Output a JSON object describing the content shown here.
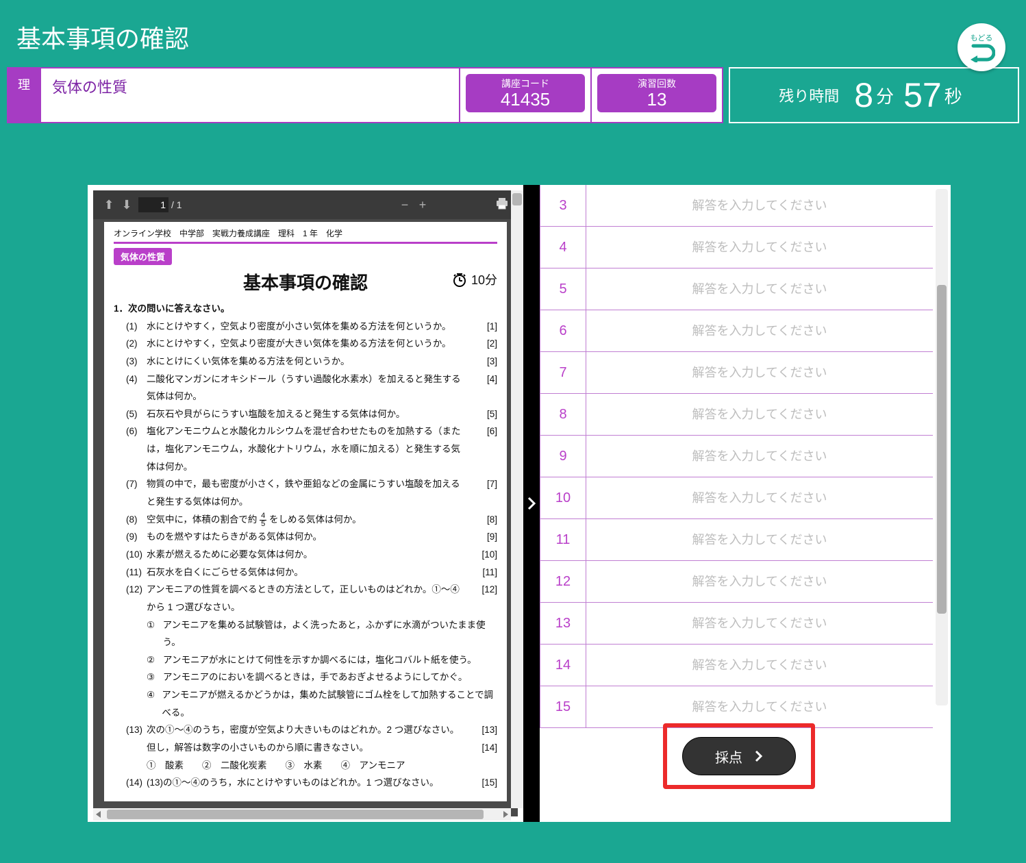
{
  "header": {
    "page_title": "基本事項の確認",
    "back_label": "もどる"
  },
  "info": {
    "subject_tab": "理",
    "topic": "気体の性質",
    "course_code_label": "講座コード",
    "course_code_value": "41435",
    "exercise_count_label": "演習回数",
    "exercise_count_value": "13",
    "timer_label": "残り時間",
    "timer_minutes": "8",
    "timer_minutes_unit": "分",
    "timer_seconds": "57",
    "timer_seconds_unit": "秒"
  },
  "pdf": {
    "toolbar": {
      "page_current": "1",
      "page_total": "/ 1"
    },
    "meta_line": "オンライン学校　中学部　実戦力養成講座　理科　1 年　化学",
    "tag": "気体の性質",
    "title": "基本事項の確認",
    "time_limit": "10分",
    "lead": "1．次の問いに答えなさい。",
    "questions": [
      {
        "n": "(1)",
        "t": "水にとけやすく，空気より密度が小さい気体を集める方法を何というか。",
        "r": "[1]"
      },
      {
        "n": "(2)",
        "t": "水にとけやすく，空気より密度が大きい気体を集める方法を何というか。",
        "r": "[2]"
      },
      {
        "n": "(3)",
        "t": "水にとけにくい気体を集める方法を何というか。",
        "r": "[3]"
      },
      {
        "n": "(4)",
        "t": "二酸化マンガンにオキシドール（うすい過酸化水素水）を加えると発生する気体は何か。",
        "r": "[4]"
      },
      {
        "n": "(5)",
        "t": "石灰石や貝がらにうすい塩酸を加えると発生する気体は何か。",
        "r": "[5]"
      },
      {
        "n": "(6)",
        "t": "塩化アンモニウムと水酸化カルシウムを混ぜ合わせたものを加熱する（または，塩化アンモニウム，水酸化ナトリウム，水を順に加える）と発生する気体は何か。",
        "r": "[6]"
      },
      {
        "n": "(7)",
        "t": "物質の中で，最も密度が小さく，鉄や亜鉛などの金属にうすい塩酸を加えると発生する気体は何か。",
        "r": "[7]"
      },
      {
        "n": "(8)",
        "t": "空気中に，体積の割合で約 4/5 をしめる気体は何か。",
        "r": "[8]",
        "fraction": {
          "num": "4",
          "den": "5"
        }
      },
      {
        "n": "(9)",
        "t": "ものを燃やすはたらきがある気体は何か。",
        "r": "[9]"
      },
      {
        "n": "(10)",
        "t": "水素が燃えるために必要な気体は何か。",
        "r": "[10]"
      },
      {
        "n": "(11)",
        "t": "石灰水を白くにごらせる気体は何か。",
        "r": "[11]"
      },
      {
        "n": "(12)",
        "t": "アンモニアの性質を調べるときの方法として，正しいものはどれか。①〜④から 1 つ選びなさい。",
        "r": "[12]",
        "options": [
          {
            "on": "①",
            "ot": "アンモニアを集める試験管は，よく洗ったあと，ふかずに水滴がついたまま使う。"
          },
          {
            "on": "②",
            "ot": "アンモニアが水にとけて何性を示すか調べるには，塩化コバルト紙を使う。"
          },
          {
            "on": "③",
            "ot": "アンモニアのにおいを調べるときは，手であおぎよせるようにしてかぐ。"
          },
          {
            "on": "④",
            "ot": "アンモニアが燃えるかどうかは，集めた試験管にゴム栓をして加熱することで調べる。"
          }
        ]
      },
      {
        "n": "(13)",
        "t": "次の①〜④のうち，密度が空気より大きいものはどれか。2 つ選びなさい。但し，解答は数字の小さいものから順に書きなさい。",
        "r": "[13] [14]",
        "options_inline": "①　酸素　　②　二酸化炭素　　③　水素　　④　アンモニア"
      },
      {
        "n": "(14)",
        "t": "(13)の①〜④のうち，水にとけやすいものはどれか。1 つ選びなさい。",
        "r": "[15]"
      }
    ]
  },
  "answers": {
    "placeholder": "解答を入力してください",
    "rows": [
      3,
      4,
      5,
      6,
      7,
      8,
      9,
      10,
      11,
      12,
      13,
      14,
      15
    ]
  },
  "grade_button": "採点"
}
